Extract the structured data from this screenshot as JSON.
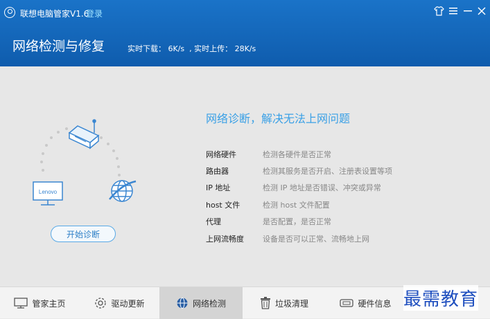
{
  "header": {
    "app_title": "联想电脑管家V1.6",
    "login_label": "登录",
    "page_title": "网络检测与修复",
    "speed_text": "实时下载： 6K/s  , 实时上传： 28K/s"
  },
  "window_controls": [
    "shirt-icon",
    "menu-icon",
    "minimize-icon",
    "close-icon"
  ],
  "diagnosis": {
    "heading": "网络诊断，解决无法上网问题",
    "items": [
      {
        "name": "网络硬件",
        "desc": "检测各硬件是否正常"
      },
      {
        "name": "路由器",
        "desc": "检测其服务是否开启、注册表设置等项"
      },
      {
        "name": "IP 地址",
        "desc": "检测 IP 地址是否错误、冲突或异常"
      },
      {
        "name": "host 文件",
        "desc": "检测 host 文件配置"
      },
      {
        "name": "代理",
        "desc": "是否配置，是否正常"
      },
      {
        "name": "上网流畅度",
        "desc": "设备是否可以正常、流畅地上网"
      }
    ],
    "monitor_brand": "Lenovo",
    "start_button": "开始诊断"
  },
  "bottom_nav": [
    {
      "label": "管家主页",
      "icon": "monitor-icon",
      "active": false
    },
    {
      "label": "驱动更新",
      "icon": "gear-icon",
      "active": false
    },
    {
      "label": "网络检测",
      "icon": "globe-icon",
      "active": true
    },
    {
      "label": "垃圾清理",
      "icon": "trash-icon",
      "active": false
    },
    {
      "label": "硬件信息",
      "icon": "hardware-icon",
      "active": false
    }
  ],
  "watermark": "最需教育",
  "colors": {
    "header": "#1565c0",
    "accent": "#3aa0e6",
    "background": "#e7e7e7"
  }
}
